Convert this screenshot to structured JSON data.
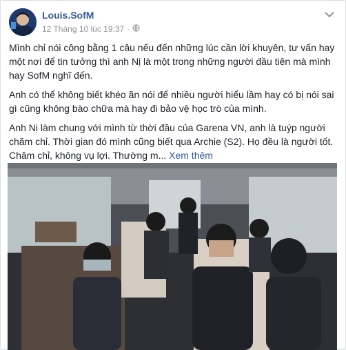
{
  "post": {
    "author": "Louis.SofM",
    "timestamp": "12 Tháng 10 lúc 19:37",
    "separator": "·",
    "paragraphs": [
      "Mình chỉ nói công bằng 1 câu nếu đến những lúc cần lời khuyên, tư vấn hay một nơi để tin tưởng thì anh Nị là một trong những người đầu tiên mà mình hay SofM nghĩ đến.",
      "Anh có thể không biết khéo ăn nói để nhiều người hiểu lầm hay có bị nói sai gì cũng không bào chữa mà hay đi bảo vệ học trò của mình.",
      "Anh Nị làm chung với mình từ thời đầu của Garena VN, anh là tuýp người chăm chỉ. Thời gian đó mình cũng biết qua Archie (S2). Họ đều là người tốt. Chăm chỉ, không vụ lợi. Thường m..."
    ],
    "see_more": "Xem thêm"
  },
  "icons": {
    "privacy": "globe-icon",
    "options": "chevron-down-icon",
    "avatar": "avatar"
  },
  "colors": {
    "link": "#365899",
    "text": "#1d2129",
    "meta": "#90949c"
  }
}
